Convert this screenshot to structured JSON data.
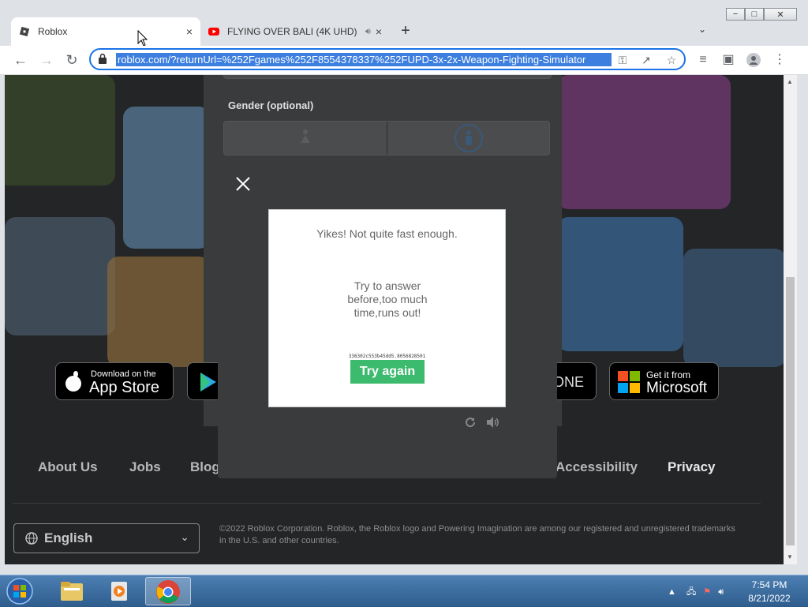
{
  "window": {
    "minimize": "−",
    "maximize": "□",
    "close": "✕"
  },
  "tabs": [
    {
      "label": "Roblox",
      "icon": "roblox-icon",
      "close": "×"
    },
    {
      "label": "FLYING OVER BALI (4K UHD)",
      "icon": "youtube-icon",
      "audio_icon": "speaker-icon",
      "close": "×"
    }
  ],
  "new_tab": "+",
  "tab_menu": "⌄",
  "toolbar": {
    "url": "roblox.com/?returnUrl=%252Fgames%252F8554378337%252FUPD-3x-2x-Weapon-Fighting-Simulator"
  },
  "page": {
    "gender_label": "Gender (optional)",
    "stores": {
      "app_store_small": "Download on the",
      "app_store_big": "App Store",
      "xbox_partial": "ONE",
      "microsoft_small": "Get it from",
      "microsoft_big": "Microsoft"
    },
    "footer": {
      "links": [
        "About Us",
        "Jobs",
        "Blog",
        "Accessibility",
        "Privacy"
      ],
      "language": "English",
      "copyright": "©2022 Roblox Corporation. Roblox, the Roblox logo and Powering Imagination are among our registered and unregistered trademarks in the U.S. and other countries."
    }
  },
  "modal": {
    "title": "Yikes! Not quite fast enough.",
    "body": "Try to answer before,too much time,runs out!",
    "hash": "336302c553b45dd5.8056828501",
    "button": "Try again"
  },
  "taskbar": {
    "time": "7:54 PM",
    "date": "8/21/2022"
  },
  "colors": {
    "accent": "#1a73e8",
    "button_green": "#3cba6d",
    "modal_bg": "#393b3d"
  }
}
